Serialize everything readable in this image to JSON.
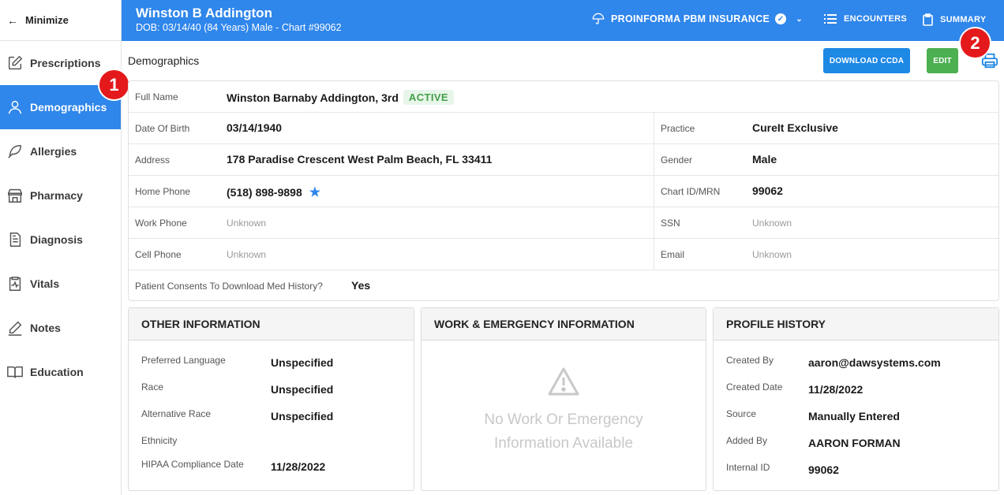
{
  "sidebar": {
    "minimize_label": "Minimize",
    "items": [
      {
        "label": "Prescriptions",
        "icon": "pencil-square-icon"
      },
      {
        "label": "Demographics",
        "icon": "person-icon",
        "active": true
      },
      {
        "label": "Allergies",
        "icon": "feather-icon"
      },
      {
        "label": "Pharmacy",
        "icon": "store-icon"
      },
      {
        "label": "Diagnosis",
        "icon": "document-icon"
      },
      {
        "label": "Vitals",
        "icon": "clipboard-pulse-icon"
      },
      {
        "label": "Notes",
        "icon": "pencil-icon"
      },
      {
        "label": "Education",
        "icon": "book-icon"
      }
    ]
  },
  "header": {
    "patient_name": "Winston B Addington",
    "patient_sub": "DOB: 03/14/40 (84 Years) Male - Chart #99062",
    "insurance": "PROINFORMA PBM INSURANCE",
    "encounters": "ENCOUNTERS",
    "summary": "SUMMARY",
    "accent_color": "#2f86eb"
  },
  "title_row": {
    "section_title": "Demographics",
    "download_ccda": "DOWNLOAD CCDA",
    "edit": "EDIT"
  },
  "markers": {
    "one": "1",
    "two": "2"
  },
  "demographics": {
    "full_name_label": "Full Name",
    "full_name": "Winston Barnaby Addington, 3rd",
    "status": "ACTIVE",
    "dob_label": "Date Of Birth",
    "dob": "03/14/1940",
    "practice_label": "Practice",
    "practice": "CureIt Exclusive",
    "address_label": "Address",
    "address": "178 Paradise Crescent West Palm Beach, FL 33411",
    "gender_label": "Gender",
    "gender": "Male",
    "home_phone_label": "Home Phone",
    "home_phone": "(518) 898-9898",
    "chart_id_label": "Chart ID/MRN",
    "chart_id": "99062",
    "work_phone_label": "Work Phone",
    "work_phone": "Unknown",
    "ssn_label": "SSN",
    "ssn": "Unknown",
    "cell_phone_label": "Cell Phone",
    "cell_phone": "Unknown",
    "email_label": "Email",
    "email": "Unknown",
    "consent_label": "Patient Consents To Download Med History?",
    "consent": "Yes"
  },
  "other_information": {
    "title": "OTHER INFORMATION",
    "rows": [
      {
        "label": "Preferred Language",
        "value": "Unspecified"
      },
      {
        "label": "Race",
        "value": "Unspecified"
      },
      {
        "label": "Alternative Race",
        "value": "Unspecified"
      },
      {
        "label": "Ethnicity",
        "value": ""
      },
      {
        "label": "HIPAA Compliance Date",
        "value": "11/28/2022"
      }
    ]
  },
  "work_emergency": {
    "title": "WORK & EMERGENCY INFORMATION",
    "empty_line1": "No Work Or Emergency",
    "empty_line2": "Information Available"
  },
  "profile_history": {
    "title": "PROFILE HISTORY",
    "rows": [
      {
        "label": "Created By",
        "value": "aaron@dawsystems.com"
      },
      {
        "label": "Created Date",
        "value": "11/28/2022"
      },
      {
        "label": "Source",
        "value": "Manually Entered"
      },
      {
        "label": "Added By",
        "value": "AARON FORMAN"
      },
      {
        "label": "Internal ID",
        "value": "99062"
      }
    ]
  }
}
